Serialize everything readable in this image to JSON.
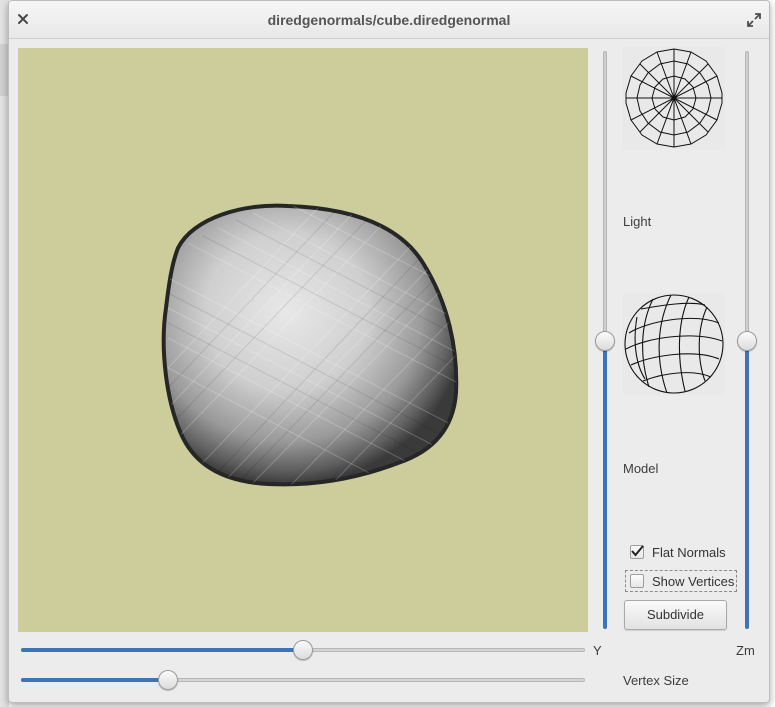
{
  "window": {
    "title": "diredgenormals/cube.diredgenormal"
  },
  "icons": {
    "close": "close-icon",
    "maximize": "maximize-icon",
    "check": "check-icon"
  },
  "colors": {
    "viewport_background": "#cdcd9b",
    "slider_accent": "#3b74b7"
  },
  "sidebar": {
    "light_label": "Light",
    "model_label": "Model",
    "flat_normals": {
      "label": "Flat Normals",
      "checked": true
    },
    "show_vertices": {
      "label": "Show Vertices",
      "checked": false
    },
    "subdivide_label": "Subdivide"
  },
  "sliders": {
    "y": {
      "label": "Y",
      "fraction": 0.5
    },
    "zm": {
      "label": "Zm",
      "fraction": 0.5
    },
    "light_vertical": {
      "fraction": 0.5
    },
    "vertex_size": {
      "label": "Vertex Size",
      "fraction": 0.26
    }
  }
}
